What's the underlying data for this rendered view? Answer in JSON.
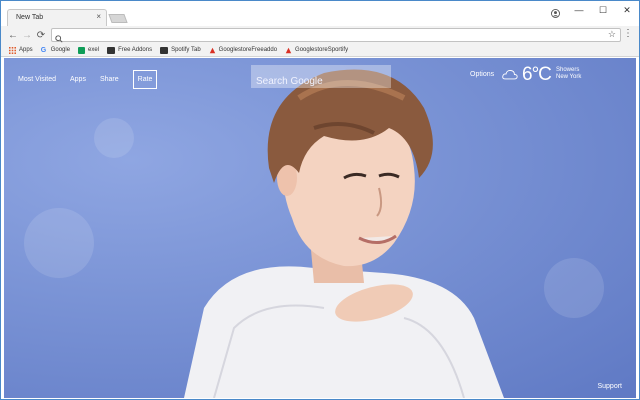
{
  "browser": {
    "tab_title": "New Tab",
    "tab_close": "×",
    "window_minimize": "—",
    "window_maximize": "☐",
    "window_close": "✕"
  },
  "bookmarks": [
    {
      "label": "Apps",
      "icon": "apps-grid-icon"
    },
    {
      "label": "Google",
      "icon": "google-icon"
    },
    {
      "label": "exel",
      "icon": "sheets-icon"
    },
    {
      "label": "Free Addons",
      "icon": "addons-icon"
    },
    {
      "label": "Spotify Tab",
      "icon": "spotify-icon"
    },
    {
      "label": "GooglestoreFreeaddo",
      "icon": "store-icon"
    },
    {
      "label": "GooglestoreSportify",
      "icon": "store-icon"
    }
  ],
  "page": {
    "nav": [
      "Most Visited",
      "Apps",
      "Share"
    ],
    "rate": "Rate",
    "search_placeholder": "Search Google",
    "options": "Options",
    "temperature": "6°C",
    "condition": "Showers",
    "city": "New York",
    "support": "Support"
  },
  "colors": {
    "background": "#7b94d6",
    "window_border": "#4a89c9",
    "chrome": "#f2f2f2"
  }
}
